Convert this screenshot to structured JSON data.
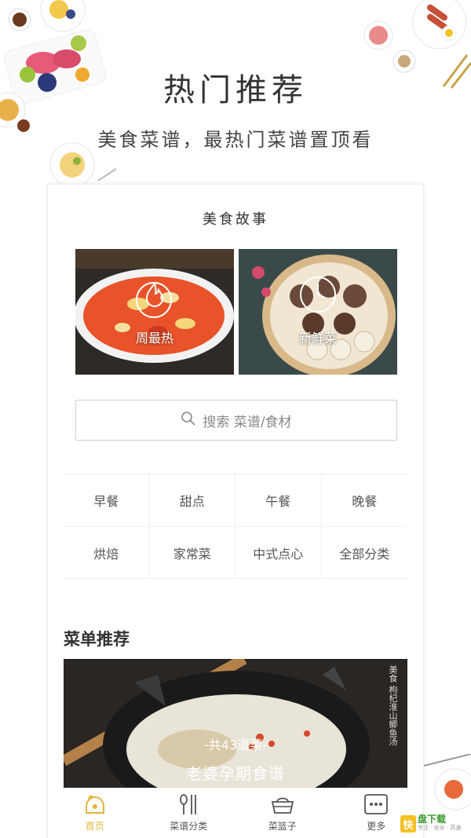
{
  "hero": {
    "title": "热门推荐",
    "subtitle": "美食菜谱，最热门菜谱置顶看"
  },
  "stories": {
    "title": "美食故事",
    "items": [
      {
        "label": "周最热",
        "icon": "flame-icon"
      },
      {
        "label": "新鲜菜",
        "icon": "clock-icon"
      }
    ]
  },
  "search": {
    "placeholder": "搜索  菜谱/食材"
  },
  "categories": [
    "早餐",
    "甜点",
    "午餐",
    "晚餐",
    "烘焙",
    "家常菜",
    "中式点心",
    "全部分类"
  ],
  "menu": {
    "section_title": "菜单推荐",
    "count_text": "-共43道菜-",
    "name": "老婆孕期食谱",
    "calligraphy": "美食 枸杞淮山鲫鱼汤"
  },
  "tabbar": [
    {
      "label": "首页",
      "icon": "home-icon",
      "active": true
    },
    {
      "label": "菜谱分类",
      "icon": "utensils-icon",
      "active": false
    },
    {
      "label": "菜篮子",
      "icon": "basket-icon",
      "active": false
    },
    {
      "label": "更多",
      "icon": "more-icon",
      "active": false
    }
  ],
  "watermark": {
    "badge": "快",
    "main": "盘下载",
    "sub": "专注 · 安全 · 高速"
  },
  "colors": {
    "accent": "#e4b43a",
    "text": "#333333",
    "border": "#efefef"
  }
}
